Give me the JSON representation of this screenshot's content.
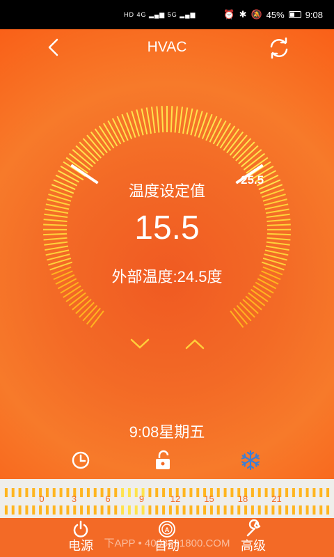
{
  "status_bar": {
    "left_text": "HD 4G ▂▄▆ 5G ▂▄▆",
    "battery": "45%",
    "time": "9:08"
  },
  "header": {
    "title": "HVAC",
    "back_icon": "chevron-left-icon",
    "refresh_icon": "refresh-icon"
  },
  "dial": {
    "setpoint_label": "温度设定值",
    "setpoint_value": "15.5",
    "outside_temperature": "外部温度:24.5度",
    "max_marker_label": "25.5"
  },
  "datetime": "9:08星期五",
  "mode_icons": [
    "clock-icon",
    "unlock-icon",
    "snowflake-icon"
  ],
  "timeline": {
    "hour_labels": [
      "0",
      "3",
      "6",
      "9",
      "12",
      "15",
      "18",
      "21"
    ]
  },
  "bottom_nav": {
    "power_label": "电源",
    "auto_label": "自动",
    "advanced_label": "高级"
  },
  "watermark": "下APP • 4008891800.COM",
  "colors": {
    "background": "#f36a26",
    "tick_yellow": "#ffe34d",
    "tick_orange": "#ffb51f",
    "accent_white": "#ffffff"
  }
}
